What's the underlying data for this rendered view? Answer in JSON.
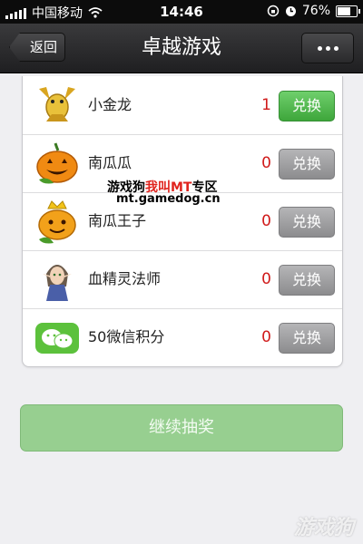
{
  "status_bar": {
    "carrier": "中国移动",
    "time": "14:46",
    "battery_percent": "76%",
    "battery_level": 0.76
  },
  "navbar": {
    "back_label": "返回",
    "title": "卓越游戏",
    "more_icon": "more-dots-icon"
  },
  "items": [
    {
      "name": "小金龙",
      "count": "1",
      "redeem_label": "兑换",
      "enabled": true,
      "icon": "golden-dragon-icon"
    },
    {
      "name": "南瓜瓜",
      "count": "0",
      "redeem_label": "兑换",
      "enabled": false,
      "icon": "pumpkin-icon"
    },
    {
      "name": "南瓜王子",
      "count": "0",
      "redeem_label": "兑换",
      "enabled": false,
      "icon": "pumpkin-prince-icon"
    },
    {
      "name": "血精灵法师",
      "count": "0",
      "redeem_label": "兑换",
      "enabled": false,
      "icon": "blood-elf-mage-icon"
    },
    {
      "name": "50微信积分",
      "count": "0",
      "redeem_label": "兑换",
      "enabled": false,
      "icon": "wechat-icon"
    }
  ],
  "watermark": {
    "line1_prefix": "游戏狗",
    "line1_highlight": "我叫MT",
    "line1_suffix": "专区",
    "line2": "mt.gamedog.cn",
    "corner": "游戏狗"
  },
  "continue_label": "继续抽奖",
  "colors": {
    "accent_green": "#3ea63b",
    "count_red": "#d01a1a",
    "disabled_gray": "#8c8c8e",
    "continue_green": "#97cf90"
  }
}
